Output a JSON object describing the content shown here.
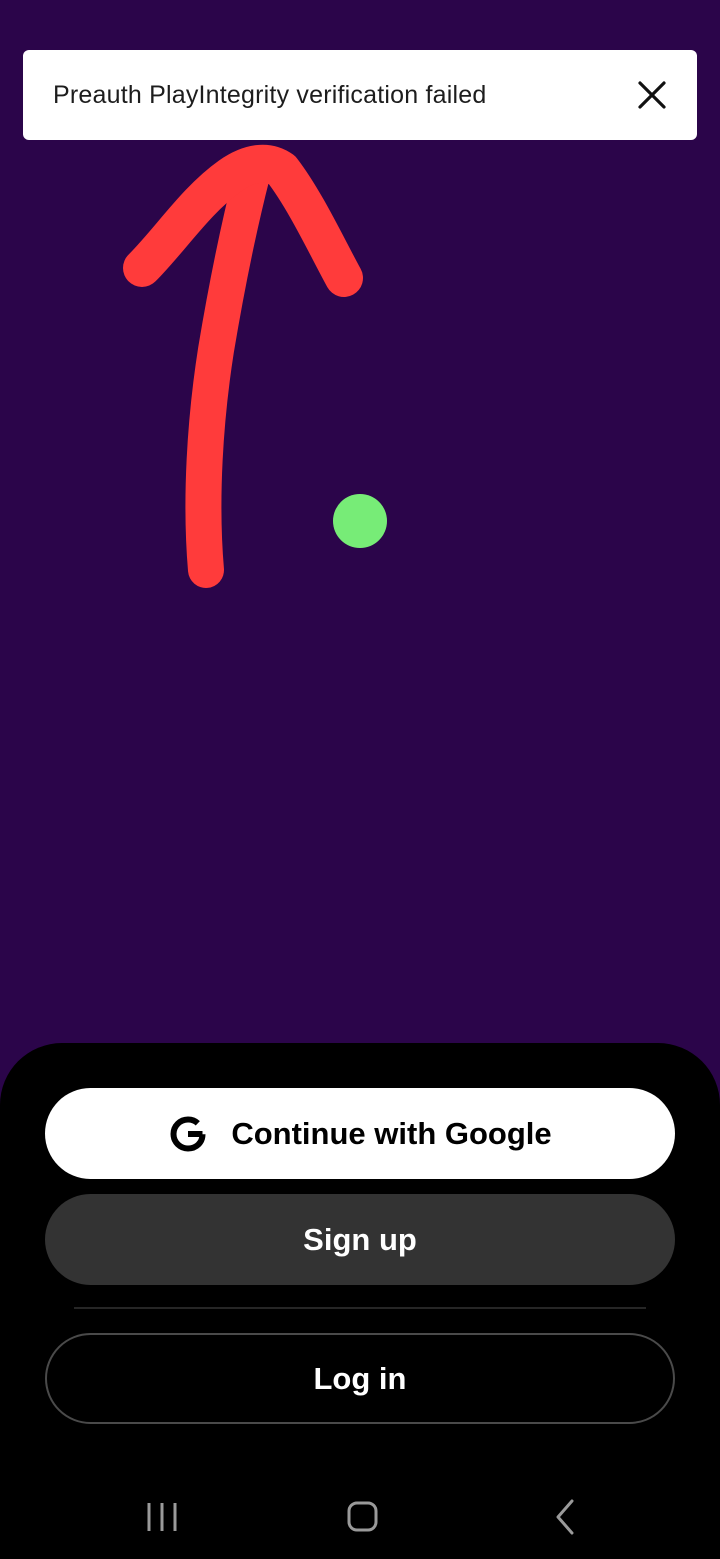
{
  "toast": {
    "message": "Preauth PlayIntegrity verification failed",
    "close_icon": "close-icon"
  },
  "annotation": {
    "arrow_color": "#ff3b3b",
    "touch_indicator_color": "#77ec77"
  },
  "auth_sheet": {
    "google_button": {
      "label": "Continue with Google",
      "icon": "google-icon"
    },
    "signup_button": {
      "label": "Sign up"
    },
    "login_button": {
      "label": "Log in"
    }
  },
  "system_nav": {
    "recents_icon": "recents-icon",
    "home_icon": "home-icon",
    "back_icon": "back-icon"
  },
  "colors": {
    "background": "#2b054a",
    "sheet": "#000000",
    "signup_button": "#333333"
  }
}
